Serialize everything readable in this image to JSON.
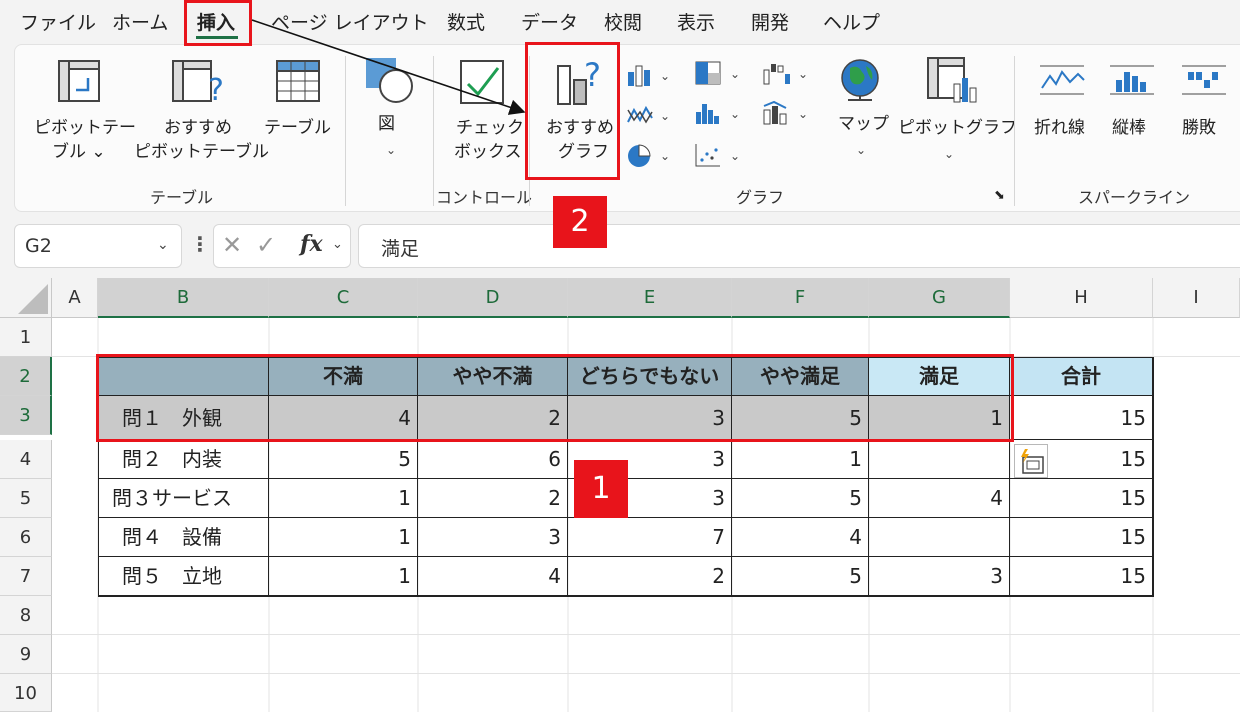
{
  "menu": {
    "tabs": [
      "ファイル",
      "ホーム",
      "挿入",
      "ページ レイアウト",
      "数式",
      "データ",
      "校閲",
      "表示",
      "開発",
      "ヘルプ"
    ],
    "active_tab": "挿入"
  },
  "ribbon": {
    "pivot_table": [
      "ピボットテー",
      "ブル ⌄"
    ],
    "recommended_pivot": [
      "おすすめ",
      "ピボットテーブル"
    ],
    "table": "テーブル",
    "illustrations": "図",
    "checkbox": [
      "チェック",
      "ボックス"
    ],
    "recommended_charts": [
      "おすすめ",
      "グラフ"
    ],
    "maps": "マップ",
    "pivot_chart": "ピボットグラフ",
    "spark_line": "折れ線",
    "spark_column": "縦棒",
    "spark_winloss": "勝敗",
    "group_table": "テーブル",
    "group_controls": "コントロール",
    "group_charts": "グラフ",
    "group_sparklines": "スパークライン"
  },
  "formula_bar": {
    "name_box": "G2",
    "fx": "fx",
    "value": "満足"
  },
  "grid": {
    "columns": [
      "A",
      "B",
      "C",
      "D",
      "E",
      "F",
      "G",
      "H",
      "I"
    ],
    "rows": [
      "1",
      "2",
      "3",
      "4",
      "5",
      "6",
      "7",
      "8",
      "9",
      "10"
    ],
    "headers": [
      "不満",
      "やや不満",
      "どちらでもない",
      "やや満足",
      "満足",
      "合計"
    ],
    "data": [
      {
        "label": "問１　外観",
        "values": [
          "4",
          "2",
          "3",
          "5",
          "1"
        ],
        "total": "15"
      },
      {
        "label": "問２　内装",
        "values": [
          "5",
          "6",
          "3",
          "1",
          ""
        ],
        "total": "15"
      },
      {
        "label": "問３サービス",
        "values": [
          "1",
          "2",
          "3",
          "5",
          "4"
        ],
        "total": "15"
      },
      {
        "label": "問４　設備",
        "values": [
          "1",
          "3",
          "7",
          "4",
          ""
        ],
        "total": "15"
      },
      {
        "label": "問５　立地",
        "values": [
          "1",
          "4",
          "2",
          "5",
          "3"
        ],
        "total": "15"
      }
    ]
  },
  "annotations": {
    "badge1": "1",
    "badge2": "2",
    "highlight_color": "#e8141b"
  }
}
